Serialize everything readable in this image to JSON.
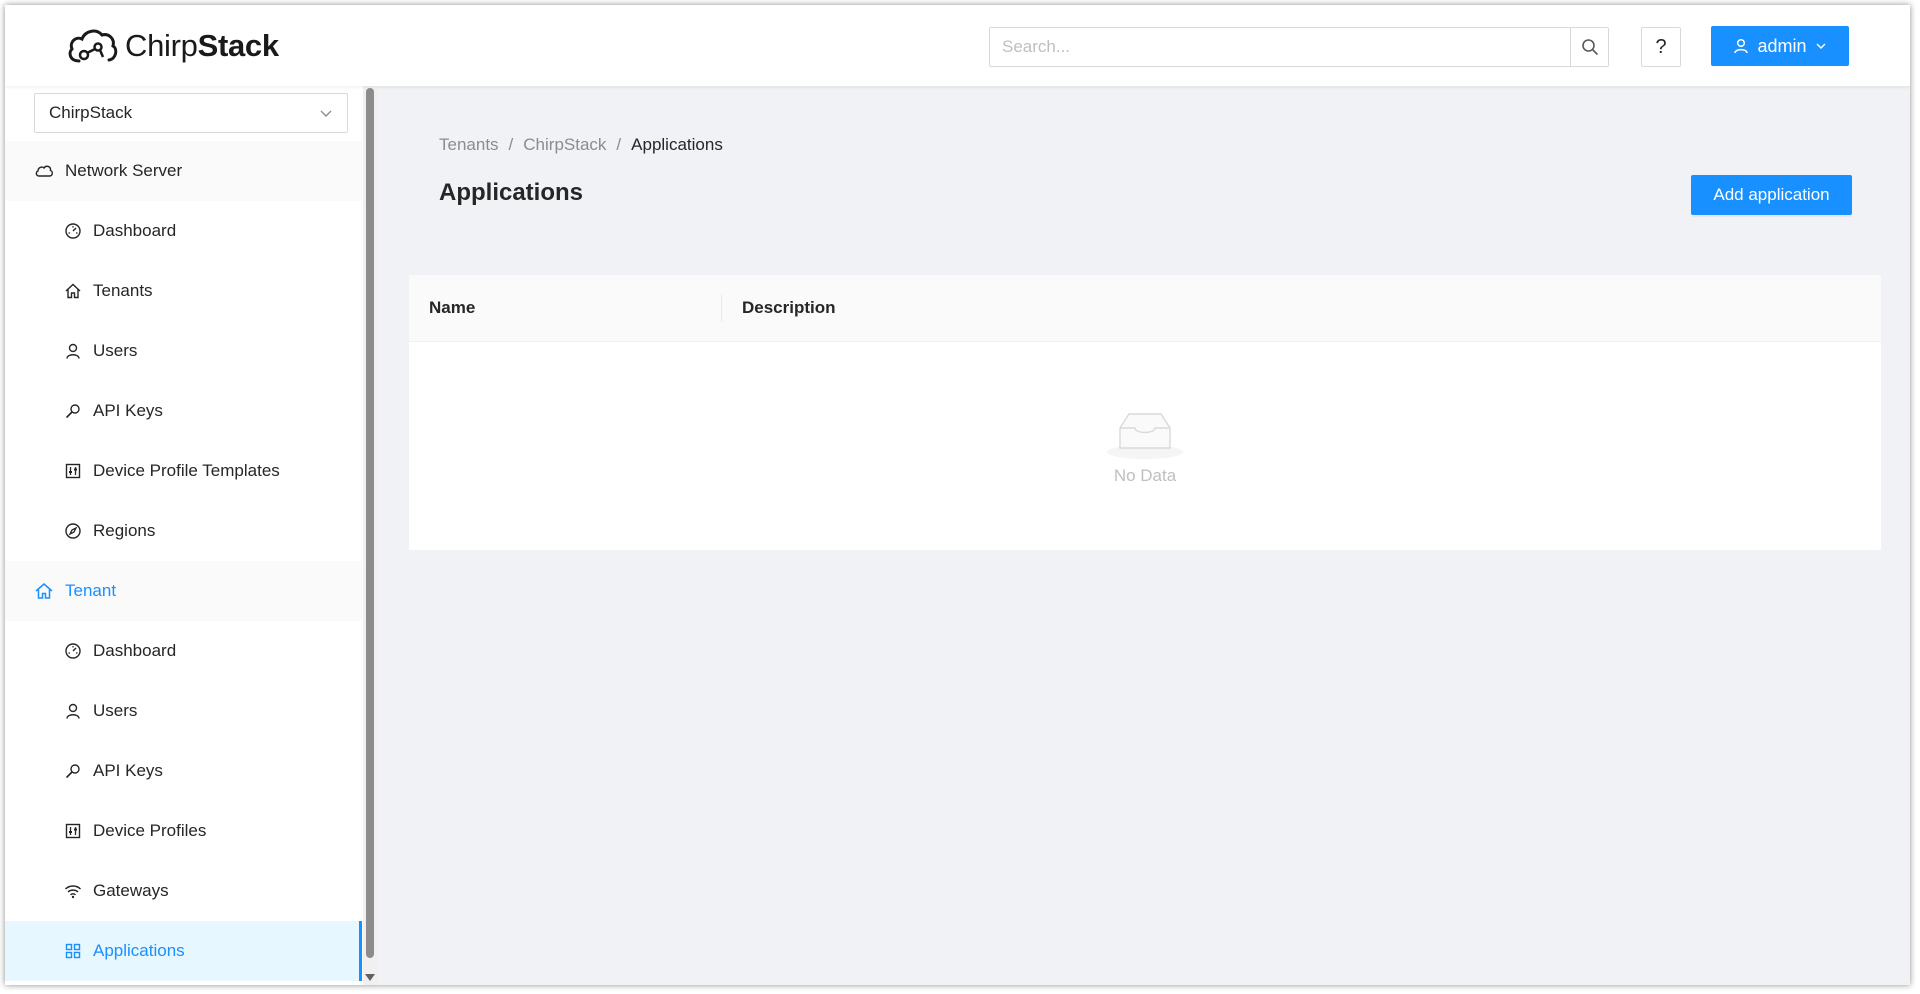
{
  "header": {
    "logo_prefix": "Chirp",
    "logo_suffix": "Stack",
    "search_placeholder": "Search...",
    "help_label": "?",
    "user_label": "admin"
  },
  "sidebar": {
    "tenant_select_value": "ChirpStack",
    "groups": [
      {
        "label": "Network Server",
        "icon": "cloud-icon",
        "items": [
          {
            "label": "Dashboard",
            "icon": "dashboard-icon"
          },
          {
            "label": "Tenants",
            "icon": "home-icon"
          },
          {
            "label": "Users",
            "icon": "user-icon"
          },
          {
            "label": "API Keys",
            "icon": "key-icon"
          },
          {
            "label": "Device Profile Templates",
            "icon": "control-icon"
          },
          {
            "label": "Regions",
            "icon": "compass-icon"
          }
        ]
      },
      {
        "label": "Tenant",
        "icon": "home-icon",
        "items": [
          {
            "label": "Dashboard",
            "icon": "dashboard-icon"
          },
          {
            "label": "Users",
            "icon": "user-icon"
          },
          {
            "label": "API Keys",
            "icon": "key-icon"
          },
          {
            "label": "Device Profiles",
            "icon": "control-icon"
          },
          {
            "label": "Gateways",
            "icon": "wifi-icon"
          },
          {
            "label": "Applications",
            "icon": "appstore-icon"
          }
        ]
      }
    ]
  },
  "main": {
    "breadcrumb": [
      "Tenants",
      "ChirpStack",
      "Applications"
    ],
    "breadcrumb_separator": "/",
    "title": "Applications",
    "add_button_label": "Add application",
    "table": {
      "columns": [
        "Name",
        "Description"
      ],
      "empty_text": "No Data"
    }
  },
  "colors": {
    "primary": "#1890ff",
    "background": "#f0f2f5",
    "selected_bg": "#e6f7ff"
  }
}
